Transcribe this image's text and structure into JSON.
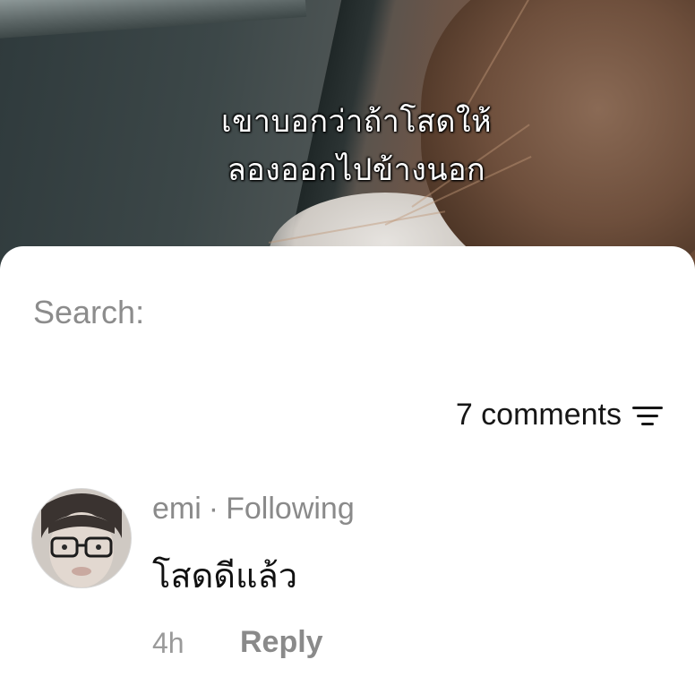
{
  "video": {
    "caption_line1": "เขาบอกว่าถ้าโสดให้",
    "caption_line2": "ลองออกไปข้างนอก"
  },
  "comments_sheet": {
    "search_label": "Search:",
    "comments_count": "7 comments",
    "filter_icon": "filter-lines-icon",
    "comment": {
      "username": "emi",
      "separator": "·",
      "relation": "Following",
      "text": "โสดดีแล้ว",
      "time": "4h",
      "reply_label": "Reply"
    }
  }
}
